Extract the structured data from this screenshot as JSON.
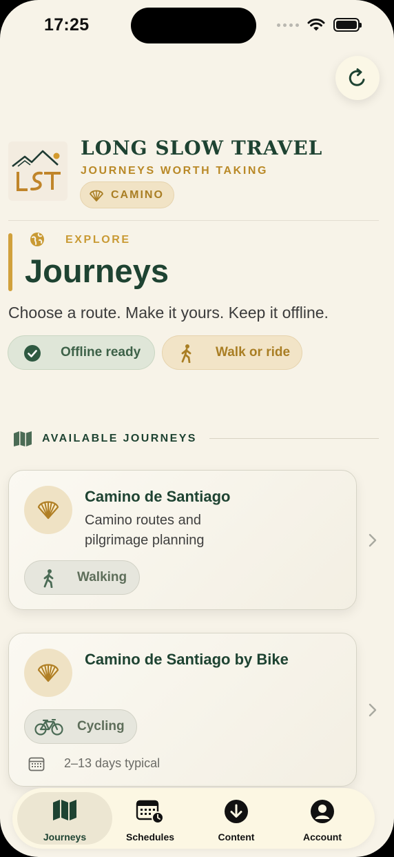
{
  "status_bar": {
    "time": "17:25"
  },
  "brand": {
    "title": "LONG SLOW TRAVEL",
    "subtitle": "JOURNEYS WORTH TAKING",
    "chip_label": "CAMINO",
    "logo_text": "LST"
  },
  "header": {
    "eyebrow": "EXPLORE",
    "title": "Journeys",
    "tagline": "Choose a route. Make it yours. Keep it offline.",
    "pills": [
      {
        "label": "Offline ready",
        "icon": "check-circle-icon"
      },
      {
        "label": "Walk or ride",
        "icon": "walking-icon"
      }
    ]
  },
  "section": {
    "label": "AVAILABLE JOURNEYS",
    "icon": "map-icon"
  },
  "journeys": [
    {
      "name": "Camino de Santiago",
      "description": "Camino routes and pilgrimage planning",
      "mode": "Walking",
      "mode_icon": "walking-icon",
      "icon": "scallop-shell-icon"
    },
    {
      "name": "Camino de Santiago by Bike",
      "description": "",
      "mode": "Cycling",
      "mode_icon": "bicycle-icon",
      "duration": "2–13 days typical",
      "icon": "scallop-shell-icon"
    }
  ],
  "tabs": [
    {
      "label": "Journeys",
      "icon": "map-icon",
      "active": true
    },
    {
      "label": "Schedules",
      "icon": "calendar-clock-icon",
      "active": false
    },
    {
      "label": "Content",
      "icon": "download-circle-icon",
      "active": false
    },
    {
      "label": "Account",
      "icon": "person-circle-icon",
      "active": false
    }
  ],
  "colors": {
    "background": "#f7f3e8",
    "primary_green": "#1e4332",
    "gold": "#c99a34",
    "chip_gold_bg": "#f2e4c7",
    "chip_green_bg": "#dfe6d8"
  }
}
